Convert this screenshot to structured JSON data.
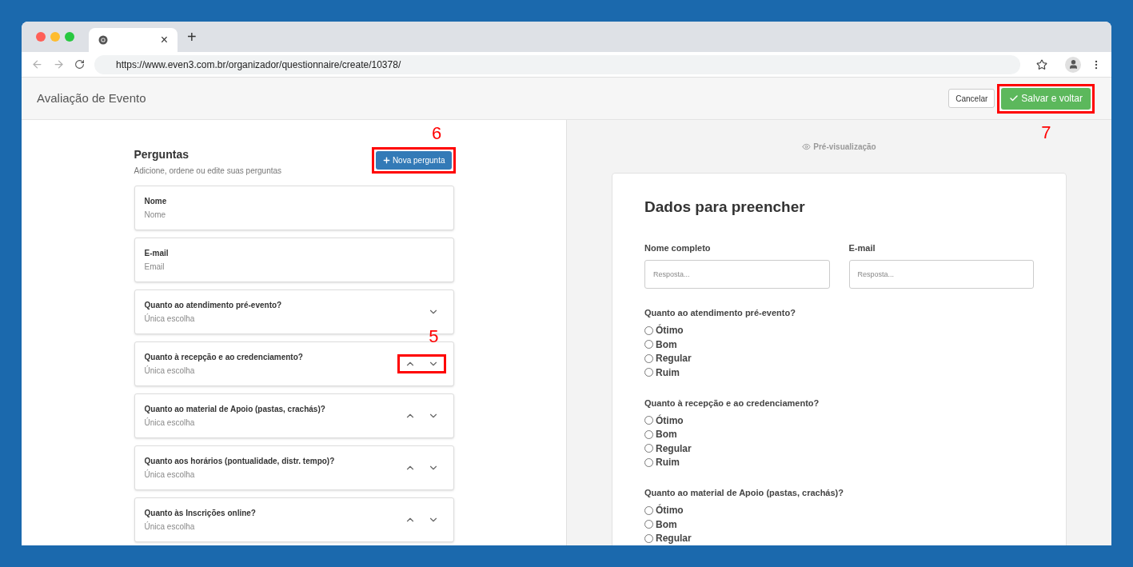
{
  "browser": {
    "tab_close": "×",
    "new_tab": "+",
    "url": "https://www.even3.com.br/organizador/questionnaire/create/10378/"
  },
  "header": {
    "title": "Avaliação de Evento",
    "cancel_button": "Cancelar",
    "save_button": {
      "label": "Salvar e voltar",
      "callout": "7"
    }
  },
  "questions_panel": {
    "title": "Perguntas",
    "subtitle": "Adicione, ordene ou edite suas perguntas",
    "new_button": {
      "label": "Nova pergunta",
      "callout": "6"
    },
    "items": [
      {
        "title": "Nome",
        "type": "Nome",
        "can_move_up": false,
        "can_move_down": false
      },
      {
        "title": "E-mail",
        "type": "Email",
        "can_move_up": false,
        "can_move_down": false
      },
      {
        "title": "Quanto ao atendimento pré-evento?",
        "type": "Única escolha",
        "can_move_up": false,
        "can_move_down": true
      },
      {
        "title": "Quanto à recepção e ao credenciamento?",
        "type": "Única escolha",
        "can_move_up": true,
        "can_move_down": true,
        "callout": "5"
      },
      {
        "title": "Quanto ao material de Apoio (pastas, crachás)?",
        "type": "Única escolha",
        "can_move_up": true,
        "can_move_down": true
      },
      {
        "title": "Quanto aos horários (pontualidade, distr. tempo)?",
        "type": "Única escolha",
        "can_move_up": true,
        "can_move_down": true
      },
      {
        "title": "Quanto às Inscrições online?",
        "type": "Única escolha",
        "can_move_up": true,
        "can_move_down": true
      }
    ]
  },
  "preview": {
    "label": "Pré-visualização",
    "title": "Dados para preencher",
    "fields": [
      {
        "label": "Nome completo",
        "placeholder": "Resposta..."
      },
      {
        "label": "E-mail",
        "placeholder": "Resposta..."
      }
    ],
    "questions": [
      {
        "title": "Quanto ao atendimento pré-evento?",
        "options": [
          {
            "label": "Ótimo",
            "selected": false
          },
          {
            "label": "Bom",
            "selected": false
          },
          {
            "label": "Regular",
            "selected": false
          },
          {
            "label": "Ruim",
            "selected": false
          }
        ]
      },
      {
        "title": "Quanto à recepção e ao credenciamento?",
        "options": [
          {
            "label": "Ótimo",
            "selected": false
          },
          {
            "label": "Bom",
            "selected": false
          },
          {
            "label": "Regular",
            "selected": false
          },
          {
            "label": "Ruim",
            "selected": false
          }
        ]
      },
      {
        "title": "Quanto ao material de Apoio (pastas, crachás)?",
        "options": [
          {
            "label": "Ótimo",
            "selected": false
          },
          {
            "label": "Bom",
            "selected": false
          },
          {
            "label": "Regular",
            "selected": false
          }
        ]
      }
    ]
  }
}
